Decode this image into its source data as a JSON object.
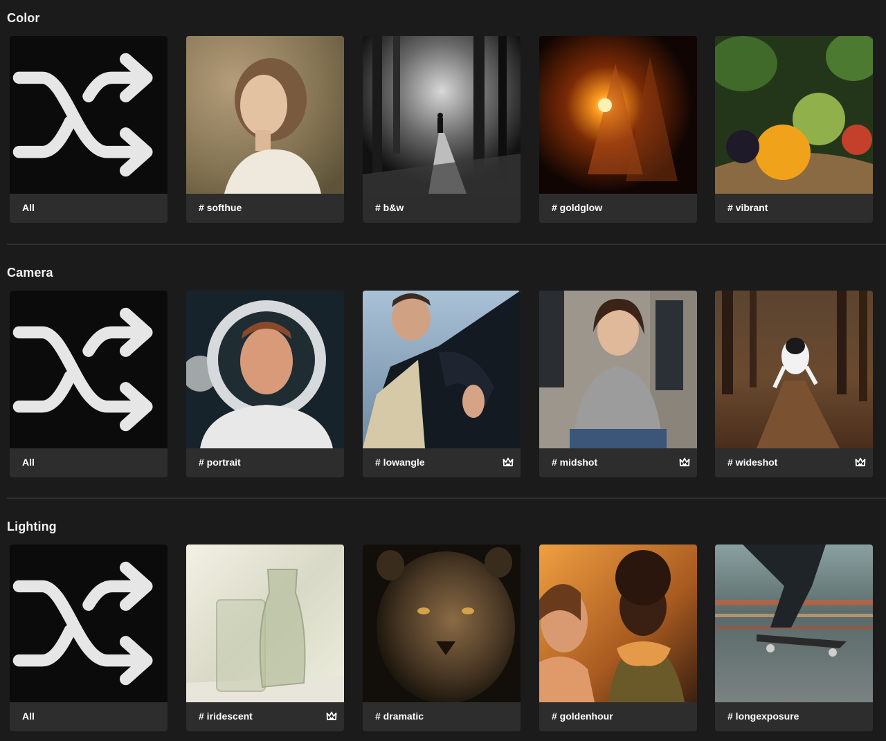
{
  "sections": [
    {
      "title": "Color",
      "cards": [
        {
          "label": "All",
          "kind": "shuffle",
          "icon": "shuffle-icon"
        },
        {
          "label": "# softhue",
          "kind": "image",
          "subject": "freckled-woman-portrait"
        },
        {
          "label": "# b&w",
          "kind": "image",
          "subject": "bw-forest-path"
        },
        {
          "label": "# goldglow",
          "kind": "image",
          "subject": "glowing-tree-night"
        },
        {
          "label": "# vibrant",
          "kind": "image",
          "subject": "fruit-basket"
        }
      ]
    },
    {
      "title": "Camera",
      "cards": [
        {
          "label": "All",
          "kind": "shuffle",
          "icon": "shuffle-icon"
        },
        {
          "label": "# portrait",
          "kind": "image",
          "subject": "astronaut-portrait"
        },
        {
          "label": "# lowangle",
          "kind": "image",
          "subject": "man-low-angle",
          "badge": "crown-icon"
        },
        {
          "label": "# midshot",
          "kind": "image",
          "subject": "woman-turtleneck-glasses",
          "badge": "crown-icon"
        },
        {
          "label": "# wideshot",
          "kind": "image",
          "subject": "dog-running-forest",
          "badge": "crown-icon"
        }
      ]
    },
    {
      "title": "Lighting",
      "cards": [
        {
          "label": "All",
          "kind": "shuffle",
          "icon": "shuffle-icon"
        },
        {
          "label": "# iridescent",
          "kind": "image",
          "subject": "glass-vases",
          "badge": "crown-icon"
        },
        {
          "label": "# dramatic",
          "kind": "image",
          "subject": "lioness-face"
        },
        {
          "label": "# goldenhour",
          "kind": "image",
          "subject": "couple-golden-hour"
        },
        {
          "label": "# longexposure",
          "kind": "image",
          "subject": "skateboarder-motion-blur"
        }
      ]
    }
  ],
  "colors": {
    "background": "#1b1b1b",
    "card": "#2d2d2d",
    "all_tile": "#0b0b0b",
    "divider": "#2e2e2e",
    "text": "#ffffff"
  }
}
